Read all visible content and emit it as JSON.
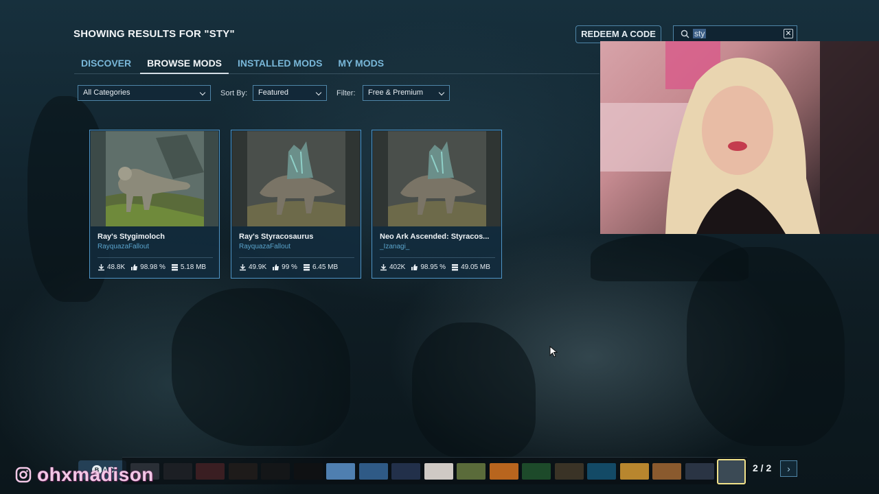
{
  "header": {
    "results_title": "SHOWING RESULTS FOR \"STY\"",
    "redeem_label": "REDEEM A CODE",
    "search_value": "sty"
  },
  "tabs": [
    {
      "label": "DISCOVER",
      "active": false
    },
    {
      "label": "BROWSE MODS",
      "active": true
    },
    {
      "label": "INSTALLED MODS",
      "active": false
    },
    {
      "label": "MY MODS",
      "active": false
    }
  ],
  "filters": {
    "category_value": "All Categories",
    "sort_label": "Sort By:",
    "sort_value": "Featured",
    "filter_label": "Filter:",
    "filter_value": "Free & Premium"
  },
  "mods": [
    {
      "name": "Ray's Stygimoloch",
      "author": "RayquazaFallout",
      "downloads": "48.8K",
      "rating": "98.98 %",
      "size": "5.18 MB"
    },
    {
      "name": "Ray's Styracosaurus",
      "author": "RayquazaFallout",
      "downloads": "49.9K",
      "rating": "99 %",
      "size": "6.45 MB"
    },
    {
      "name": "Neo Ark Ascended: Styracos...",
      "author": "_Izanagi_",
      "downloads": "402K",
      "rating": "98.95 %",
      "size": "49.05 MB"
    }
  ],
  "footer": {
    "back_label": "BAC",
    "back_key": "B",
    "page_indicator": "2 / 2"
  },
  "watermark": {
    "handle": "ohxmadison"
  },
  "colors": {
    "accent": "#4f95c7",
    "tab_inactive": "#79b7d8",
    "author": "#5aa4cc",
    "selected_thumb": "#f2e38a"
  }
}
